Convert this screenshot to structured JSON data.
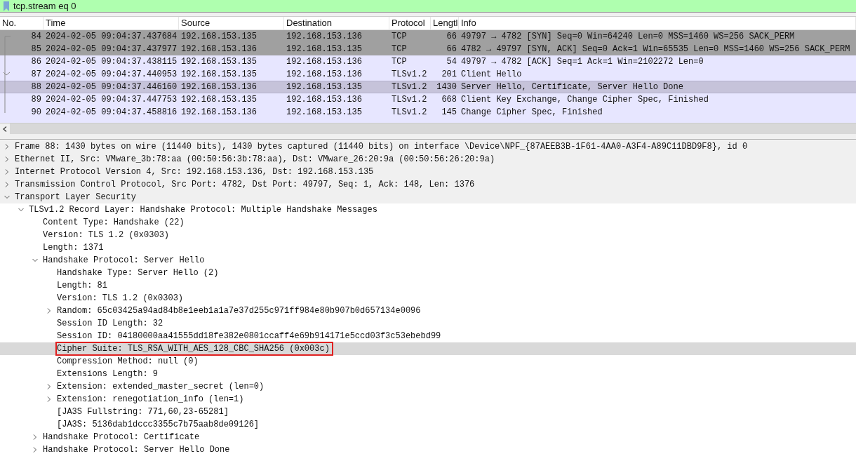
{
  "filter": {
    "value": "tcp.stream eq 0"
  },
  "packet_list": {
    "columns": [
      "No.",
      "Time",
      "Source",
      "Destination",
      "Protocol",
      "Lengtl",
      "Info"
    ],
    "rows": [
      {
        "no": "84",
        "time": "2024-02-05 09:04:37.437684",
        "source": "192.168.153.135",
        "destination": "192.168.153.136",
        "protocol": "TCP",
        "length": "66",
        "info": "49797 → 4782 [SYN] Seq=0 Win=64240 Len=0 MSS=1460 WS=256 SACK_PERM",
        "color": "#a0a0a0",
        "selected": false
      },
      {
        "no": "85",
        "time": "2024-02-05 09:04:37.437977",
        "source": "192.168.153.136",
        "destination": "192.168.153.135",
        "protocol": "TCP",
        "length": "66",
        "info": "4782 → 49797 [SYN, ACK] Seq=0 Ack=1 Win=65535 Len=0 MSS=1460 WS=256 SACK_PERM",
        "color": "#a0a0a0",
        "selected": false
      },
      {
        "no": "86",
        "time": "2024-02-05 09:04:37.438115",
        "source": "192.168.153.135",
        "destination": "192.168.153.136",
        "protocol": "TCP",
        "length": "54",
        "info": "49797 → 4782 [ACK] Seq=1 Ack=1 Win=2102272 Len=0",
        "color": "#e7e6ff",
        "selected": false
      },
      {
        "no": "87",
        "time": "2024-02-05 09:04:37.440953",
        "source": "192.168.153.135",
        "destination": "192.168.153.136",
        "protocol": "TLSv1.2",
        "length": "201",
        "info": "Client Hello",
        "color": "#e7e6ff",
        "selected": false
      },
      {
        "no": "88",
        "time": "2024-02-05 09:04:37.446160",
        "source": "192.168.153.136",
        "destination": "192.168.153.135",
        "protocol": "TLSv1.2",
        "length": "1430",
        "info": "Server Hello, Certificate, Server Hello Done",
        "color": "#c6c3da",
        "selected": true
      },
      {
        "no": "89",
        "time": "2024-02-05 09:04:37.447753",
        "source": "192.168.153.135",
        "destination": "192.168.153.136",
        "protocol": "TLSv1.2",
        "length": "668",
        "info": "Client Key Exchange, Change Cipher Spec, Finished",
        "color": "#e7e6ff",
        "selected": false
      },
      {
        "no": "90",
        "time": "2024-02-05 09:04:37.458816",
        "source": "192.168.153.136",
        "destination": "192.168.153.135",
        "protocol": "TLSv1.2",
        "length": "145",
        "info": "Change Cipher Spec, Finished",
        "color": "#e7e6ff",
        "selected": false
      }
    ]
  },
  "details": [
    {
      "label": "Frame 88: 1430 bytes on wire (11440 bits), 1430 bytes captured (11440 bits) on interface \\Device\\NPF_{87AEEB3B-1F61-4AA0-A3F4-A89C11DBD9F8}, id 0",
      "expanded": false,
      "selected": false
    },
    {
      "label": "Ethernet II, Src: VMware_3b:78:aa (00:50:56:3b:78:aa), Dst: VMware_26:20:9a (00:50:56:26:20:9a)",
      "expanded": false,
      "selected": false
    },
    {
      "label": "Internet Protocol Version 4, Src: 192.168.153.136, Dst: 192.168.153.135",
      "expanded": false,
      "selected": false
    },
    {
      "label": "Transmission Control Protocol, Src Port: 4782, Dst Port: 49797, Seq: 1, Ack: 148, Len: 1376",
      "expanded": false,
      "selected": false
    },
    {
      "label": "Transport Layer Security",
      "expanded": true,
      "selected": false,
      "children": [
        {
          "label": "TLSv1.2 Record Layer: Handshake Protocol: Multiple Handshake Messages",
          "expanded": true,
          "selected": false,
          "children": [
            {
              "label": "Content Type: Handshake (22)",
              "selected": false
            },
            {
              "label": "Version: TLS 1.2 (0x0303)",
              "selected": false
            },
            {
              "label": "Length: 1371",
              "selected": false
            },
            {
              "label": "Handshake Protocol: Server Hello",
              "expanded": true,
              "selected": false,
              "children": [
                {
                  "label": "Handshake Type: Server Hello (2)",
                  "selected": false
                },
                {
                  "label": "Length: 81",
                  "selected": false
                },
                {
                  "label": "Version: TLS 1.2 (0x0303)",
                  "selected": false
                },
                {
                  "label": "Random: 65c03425a94ad84b8e1eeb1a1a7e37d255c971ff984e80b907b0d657134e0096",
                  "expanded": false,
                  "selected": false
                },
                {
                  "label": "Session ID Length: 32",
                  "selected": false
                },
                {
                  "label": "Session ID: 04180000aa41555dd18fe382e0801ccaff4e69b914171e5ccd03f3c53ebebd99",
                  "selected": false
                },
                {
                  "label": "Cipher Suite: TLS_RSA_WITH_AES_128_CBC_SHA256 (0x003c)",
                  "selected": true,
                  "annotated": true
                },
                {
                  "label": "Compression Method: null (0)",
                  "selected": false
                },
                {
                  "label": "Extensions Length: 9",
                  "selected": false
                },
                {
                  "label": "Extension: extended_master_secret (len=0)",
                  "expanded": false,
                  "selected": false
                },
                {
                  "label": "Extension: renegotiation_info (len=1)",
                  "expanded": false,
                  "selected": false
                },
                {
                  "label": "[JA3S Fullstring: 771,60,23-65281]",
                  "selected": false
                },
                {
                  "label": "[JA3S: 5136dab1dccc3355c7b75aab8de09126]",
                  "selected": false
                }
              ]
            },
            {
              "label": "Handshake Protocol: Certificate",
              "expanded": false,
              "selected": false
            },
            {
              "label": "Handshake Protocol: Server Hello Done",
              "expanded": false,
              "selected": false
            }
          ]
        }
      ]
    }
  ]
}
